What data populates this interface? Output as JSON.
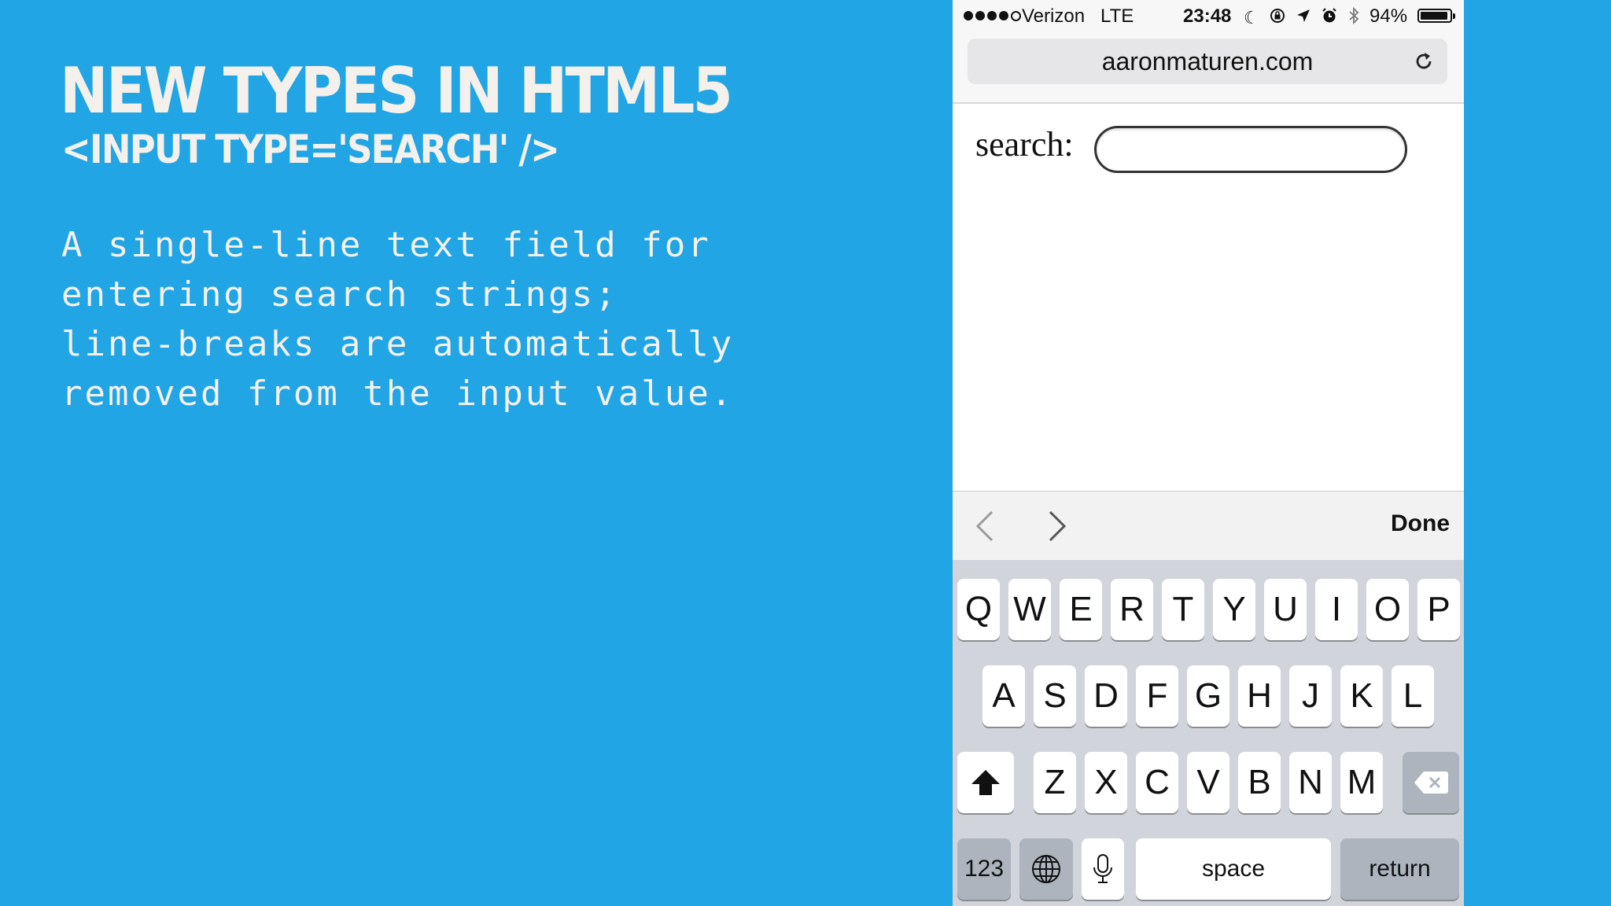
{
  "slide": {
    "title": "NEW TYPES IN HTML5",
    "subtitle": "<INPUT TYPE='SEARCH' />",
    "body_lines": [
      "A single-line text field for",
      "entering search strings;",
      "line-breaks are automatically",
      "removed from the input value."
    ]
  },
  "phone": {
    "status_bar": {
      "carrier": "Verizon",
      "network": "LTE",
      "time": "23:48",
      "battery_percent": "94%",
      "battery_level": 0.94,
      "signal_bars_filled": 4,
      "signal_bars_total": 5,
      "icons": [
        "moon-icon",
        "rotation-lock-icon",
        "location-icon",
        "alarm-icon",
        "bluetooth-icon"
      ]
    },
    "browser": {
      "url": "aaronmaturen.com",
      "reload_icon": "reload-icon"
    },
    "page": {
      "search_label": "search:",
      "search_value": ""
    },
    "accessory_bar": {
      "prev_icon": "chevron-left-icon",
      "next_icon": "chevron-right-icon",
      "done_label": "Done"
    },
    "keyboard": {
      "row1": [
        "Q",
        "W",
        "E",
        "R",
        "T",
        "Y",
        "U",
        "I",
        "O",
        "P"
      ],
      "row2": [
        "A",
        "S",
        "D",
        "F",
        "G",
        "H",
        "J",
        "K",
        "L"
      ],
      "row3": [
        "Z",
        "X",
        "C",
        "V",
        "B",
        "N",
        "M"
      ],
      "numbers_label": "123",
      "space_label": "space",
      "return_label": "return",
      "shift_icon": "shift-icon",
      "delete_icon": "backspace-icon",
      "globe_icon": "globe-icon",
      "mic_icon": "microphone-icon"
    }
  },
  "colors": {
    "slide_background": "#22a5e4",
    "slide_text": "#f4f1ec",
    "keyboard_background": "#d1d5db",
    "key_dark": "#adb4bd"
  }
}
